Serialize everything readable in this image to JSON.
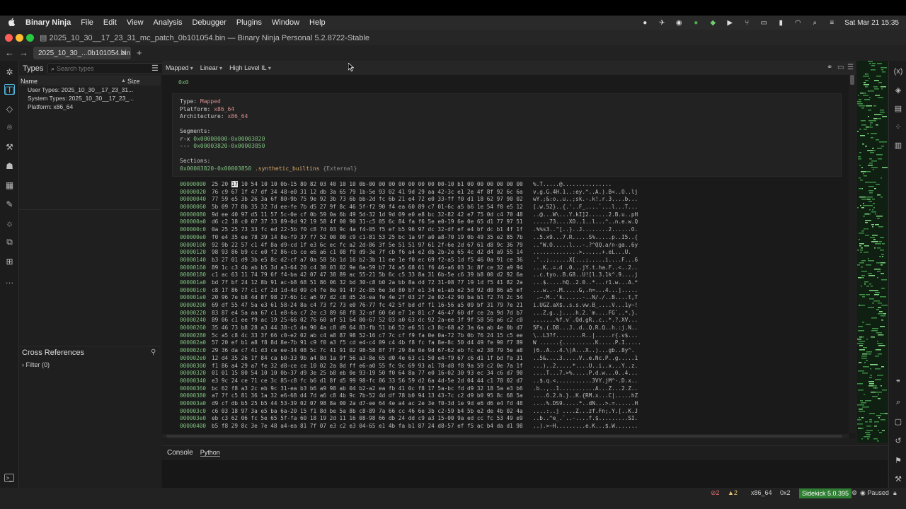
{
  "menubar": {
    "app_name": "Binary Ninja",
    "items": [
      "File",
      "Edit",
      "View",
      "Analysis",
      "Debugger",
      "Plugins",
      "Window",
      "Help"
    ],
    "datetime": "Sat Mar 21  15:35"
  },
  "window": {
    "title": "2025_10_30__17_23_31_mc_patch_0b101054.bin — Binary Ninja Personal 5.2.8722-Stable"
  },
  "tabs": [
    {
      "label": "2025_10_30_...0b101054.bin",
      "close": "✕"
    }
  ],
  "types_panel": {
    "title": "Types",
    "search_placeholder": "Search types",
    "col_name": "Name",
    "col_size": "Size",
    "rows": [
      "User Types: 2025_10_30__17_23_31...",
      "System Types: 2025_10_30__17_23_...",
      "Platform: x86_64"
    ]
  },
  "xrefs_panel": {
    "title": "Cross References",
    "filter": "Filter (0)"
  },
  "view": {
    "mapping": "Mapped",
    "layout": "Linear",
    "il": "High Level IL",
    "top_address": "0x0",
    "info": {
      "type_label": "Type:",
      "type_value": "Mapped",
      "platform_label": "Platform:",
      "platform_value": "x86_64",
      "arch_label": "Architecture:",
      "arch_value": "x86_64",
      "segments_label": "Segments:",
      "segments": [
        {
          "perm": "r-x",
          "range": "0x00000000-0x00003820"
        },
        {
          "perm": "---",
          "range": "0x00003820-0x00003850"
        }
      ],
      "sections_label": "Sections:",
      "section_range": "0x00003820-0x00003850",
      "section_name": ".synthetic_builtins",
      "section_type": "{External}"
    },
    "hex_rows": [
      {
        "addr": "00000000",
        "hex": "25 20 17 10 54 10 10 0b-15 80 82 03 40 10 10 0b-00 00 00 00 00 00 00 00-10 b1 00 00 00 00 00 00",
        "ascii": "%.T.....@..............."
      },
      {
        "addr": "00000020",
        "hex": "76 c9 67 1f 47 df 34 48-e0 31 12 db 3a 65 79 1b-5e 93 02 41 9d 29 aa 42-3c e1 2e 4f 8f 92 6c 6a",
        "ascii": "v.g.G.4H.1..:ey.^..A.).B<..O..lj"
      },
      {
        "addr": "00000040",
        "hex": "77 59 e5 3b 26 3a 6f 80-9b 75 9e 92 3b 73 6b bb-2d fc 6b 21 e4 72 e0 33-ff f0 d1 18 62 97 90 02",
        "ascii": "wY.;&:o..u..;sk.-.k!.r.3....b..."
      },
      {
        "addr": "00000060",
        "hex": "5b 09 77 8b 35 32 7d ee-fe 7b d5 27 9f 8c 46 5f-f2 90 f4 ea 60 89 c7 01-6c a5 b6 1e 54 f0 e5 12",
        "ascii": "[.w.52}..{.'..F_....`...l...T..."
      },
      {
        "addr": "00000080",
        "hex": "9d ee 40 97 d5 11 57 5c-0e cf 0b 59 0a 6b 49 5d-32 1d 9d 09 e0 e8 bc 32-82 42 e7 75 0d c4 70 48",
        "ascii": "..@...W\\...Y.kI]2......2.B.u..pH"
      },
      {
        "addr": "000000a0",
        "hex": "d6 c2 18 c0 07 37 33 89-0d 92 19 58 4f 00 90 31-c5 05 6c 84 fa f6 5e e0-19 6e 0e 65 d1 77 97 51",
        "ascii": ".....73....XO..1..l...^..n.e.w.Q"
      },
      {
        "addr": "000000c0",
        "hex": "0a 25 25 73 33 fc ed 22-5b f0 c8 7d 03 9c 4a f4-05 f5 ef b5 96 97 dc 32-df ef e4 bf dc b1 4f 1f",
        "ascii": ".%%s3..\"[..}..J........2......O."
      },
      {
        "addr": "000000e0",
        "hex": "f0 e4 35 ee 78 39 14 8e-f9 37 f7 52 00 00 c9 c1-81 53 25 bc 1a 9f a0 a8-70 19 0b 49 35 e2 85 7b",
        "ascii": "..5.x9...7.R.....S%.....p..I5..{"
      },
      {
        "addr": "00000100",
        "hex": "92 9b 22 57 c1 4f 8a d9-cd 1f e3 6c ec fc a2 2d-86 3f 5e 51 51 97 61 2f-6e 2d 67 61 d8 9c 36 79",
        "ascii": "..\"W.O.....l...-.?^QQ.a/n-ga..6y"
      },
      {
        "addr": "00000120",
        "hex": "98 93 86 b9 cc e0 f2 86-cb ce e6 a6 c1 08 f9 d9-3e 7f cb f6 a4 e2 db 2b-2e 65 4c d2 d4 a9 55 14",
        "ascii": "..............>......+.eL...U."
      },
      {
        "addr": "00000140",
        "hex": "b3 27 01 d9 3b e5 8c d2-cf a7 0a 58 5b 1d 16 b2-3b 11 ee 1e f0 ec 69 f2-a5 1d f5 46 0a 91 ce 36",
        "ascii": ".'..;......X[...;.....i....F...6"
      },
      {
        "addr": "00000160",
        "hex": "89 1c c3 4b ab b5 3d a3-64 20 c4 30 03 02 9e 6a-59 b7 74 a5 68 61 f6 46-a6 03 3c 8f ce 32 a9 94",
        "ascii": "...K..=.d .0...jY.t.ha.F..<..2.."
      },
      {
        "addr": "00000180",
        "hex": "c1 ac 63 11 74 79 6f f4-ba 42 07 47 38 89 ac 55-21 5b 6c c5 33 8a 31 6b-5e c6 39 b8 00 d2 92 6a",
        "ascii": "..c.tyo..B.G8..U![l.3.1k^.9....j"
      },
      {
        "addr": "000001a0",
        "hex": "bd 7f bf 24 12 8b 91 ac-b8 68 51 86 06 32 bd 30-c8 b0 2a bb 8a dd 72 31-08 77 19 1d f5 41 82 2a",
        "ascii": "...$.....hQ..2.0..*...r1.w...A.*"
      },
      {
        "addr": "000001c0",
        "hex": "c8 17 86 77 c1 cf 2d 1d-4d 09 c4 fe 8e 91 47 2c-85 6e 3d 80 b7 e1 34 e1-ab e2 5d 92 d0 86 a5 ef",
        "ascii": "...w..-.M.....G,.n=...4...]....."
      },
      {
        "addr": "000001e0",
        "hex": "20 96 7e b8 4d 8f 98 27-6b 1c a6 97 d2 c8 d5 2d-ea fe 4e 2f 03 2f 2e 02-42 90 ba b1 f2 74 2c 54",
        "ascii": " .~.M..'k......-..N/./..B....t,T"
      },
      {
        "addr": "00000200",
        "hex": "69 df 55 47 5a e3 61 58-24 8a c4 73 f2 73 e0 76-77 fc 42 5f bd df f1 16-56 a5 09 bf 31 79 7e 21",
        "ascii": "i.UGZ.aX$..s.s.vw.B_....V...1y~!"
      },
      {
        "addr": "00000220",
        "hex": "83 87 e4 5a aa 67 c1 e8-6a c7 2e c3 89 68 f8 32-af 60 6d e7 1e 81 c7 46-47 60 df ce 2a 9d 7d b7",
        "ascii": "...Z.g..j....h.2.`m....FG`..*.}."
      },
      {
        "addr": "00000240",
        "hex": "89 06 c1 ee f9 ac 19 25-66 02 76 60 af 51 64 00-67 52 03 a0 63 dc 92 2a-ee 3f 9f 58 56 a6 c2 c0",
        "ascii": ".......%f.v`.Qd.gR..c..*.?.XV..."
      },
      {
        "addr": "00000260",
        "hex": "35 46 73 b8 28 a3 44 38-c5 da 90 4a c8 d9 64 83-fb 51 b6 52 e6 51 c3 8c-68 a2 3a 6a ab 4e 0b d7",
        "ascii": "5Fs.(.D8...J..d..Q.R.Q..h.:j.N.."
      },
      {
        "addr": "00000280",
        "hex": "5c a5 c8 4c 33 3f 66 c0-e2 02 ab c4 a8 87 98 52-16 c7 7c cf f9 fa 0e 0a-72 7b 0b 76 24 15 c5 ee",
        "ascii": "\\..L3?f........R..|.....r{.v$..."
      },
      {
        "addr": "000002a0",
        "hex": "57 20 ef b1 a8 f8 8d 8e-7b 91 c9 f0 a3 f5 cd e4-c4 09 c4 4b f8 fc fa 8e-8c 50 d4 49 fe 90 f7 89",
        "ascii": "W ......{..........K.....P.I....."
      },
      {
        "addr": "000002c0",
        "hex": "29 36 da c7 41 d3 ce ee-34 08 5c 7c 41 91 02 98-58 8f 7f 29 8e 0e 9d 67-62 eb fc e2 38 79 5e a8",
        "ascii": ")6..A...4.\\|A...X..)...gb..8y^."
      },
      {
        "addr": "000002e0",
        "hex": "12 d4 35 26 1f 84 ca b0-33 9b a4 8d 1a 9f 56 a3-8e 65 d0 4e 63 c1 50 e4-f9 67 c6 d1 1f bd fa 31",
        "ascii": "..5&....3.....V..e.Nc.P..g.....1"
      },
      {
        "addr": "00000300",
        "hex": "f1 86 a4 29 a7 fe 32 d8-ce ce 10 02 2a 8d ff e6-a0 55 fc 9c 69 93 a1 78-d8 f8 9a 59 c2 0e 7a 1f",
        "ascii": "...)..2.....*....U..i..x...Y..z."
      },
      {
        "addr": "00000320",
        "hex": "01 01 15 80 54 10 10 0b-37 d9 3e 25 b8 eb 0e 93-19 50 f0 64 8a 77 e0 16-02 30 93 ec 34 c6 d7 90",
        "ascii": "....T...7.>%.....P.d.w...0..4..."
      },
      {
        "addr": "00000340",
        "hex": "e3 9c 24 ce 71 ce 3c 85-c8 fc b6 d1 8f d5 99 98-fc 86 33 56 59 d2 6a 4d-5e 2d 04 44 c1 78 02 d7",
        "ascii": "..$.q.<...........3VY.jM^-.D.x.."
      },
      {
        "addr": "00000360",
        "hex": "bc 62 f8 a3 2c eb 9c 31-ea b3 b6 a9 98 ab 04 b2-a2 ea fb 41 0c f8 17 5a-bc fd d9 32 18 5a e3 b6",
        "ascii": ".b..,..1...........A...Z...2.Z.."
      },
      {
        "addr": "00000380",
        "hex": "a7 7f c5 81 36 1a 32 e6-68 d4 7d a6 c8 4b 9c 7b-52 4d df 78 b0 94 13 43-7c c2 d9 b0 95 8c 68 5a",
        "ascii": "....6.2.h.}..K.{RM.x...C|.....hZ"
      },
      {
        "addr": "000003a0",
        "hex": "d9 cf db b5 25 b5 44 53-39 02 07 98 8a 00 2a d7-ee 64 4e a4 ac 2e 3e f0-3d 1e 9d e6 d6 e4 fd 48",
        "ascii": "....%.DS9.....*..dN...>.=......H"
      },
      {
        "addr": "000003c0",
        "hex": "c6 03 18 97 3a e5 ba 6a-20 15 f1 8d be 5a 8b c8-89 7a 66 cc 46 6e 3b c2-59 b4 5b e2 de 4b 02 4a",
        "ascii": "....:..j ....Z...zf.Fn;.Y.[..K.J"
      },
      {
        "addr": "000003e0",
        "hex": "eb c3 62 06 fc 5e 65 5f-fa 60 18 19 2d 11 16 08-98 66 db 24 dd c9 a3 15-00 9a ed cc fc 53 49 e9",
        "ascii": "..b..^e_.`..-....f.$.........SI."
      },
      {
        "addr": "00000400",
        "hex": "b5 f8 29 8c 3e 7e 48 a4-ea 81 7f 07 e3 c2 e3 04-65 e1 4b fa b1 87 24 d8-57 ef f5 ac b4 da d1 98",
        "ascii": "..).>~H.........e.K...$.W......."
      }
    ],
    "cursor_byte": "17"
  },
  "console": {
    "tab_console": "Console",
    "tab_python": "Python"
  },
  "statusbar": {
    "errors": "2",
    "warnings": "2",
    "arch": "x86_64",
    "offset": "0x2",
    "sidekick": "Sidekick 5.0.395",
    "state": "Paused"
  }
}
